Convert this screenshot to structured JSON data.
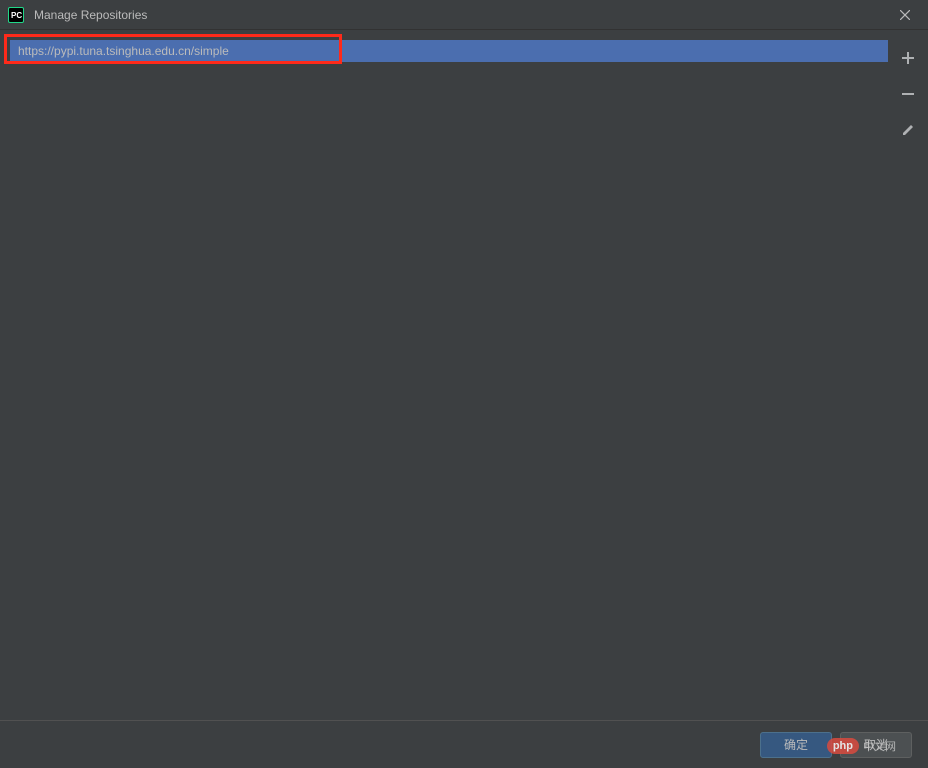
{
  "window": {
    "title": "Manage Repositories"
  },
  "repositories": {
    "items": [
      {
        "url": "https://pypi.tuna.tsinghua.edu.cn/simple"
      }
    ]
  },
  "sideButtons": {
    "add": "add-icon",
    "remove": "remove-icon",
    "edit": "edit-icon"
  },
  "footer": {
    "ok_label": "确定",
    "cancel_label": "取消"
  },
  "watermark": {
    "badge": "php",
    "text": "中文网"
  },
  "colors": {
    "selection": "#4b6eaf",
    "highlight": "#ff2a1a",
    "primaryBtn": "#365880"
  }
}
